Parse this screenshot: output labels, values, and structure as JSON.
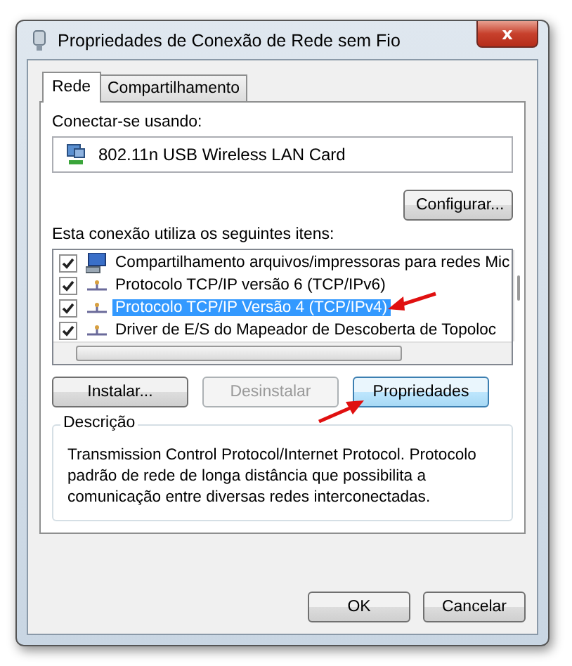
{
  "window": {
    "title": "Propriedades de Conexão de Rede sem Fio",
    "close": "x"
  },
  "tabs": [
    {
      "label": "Rede",
      "selected": true
    },
    {
      "label": "Compartilhamento",
      "selected": false
    }
  ],
  "connect_label": "Conectar-se usando:",
  "adapter": "802.11n USB Wireless LAN Card",
  "configure_button": "Configurar...",
  "items_label": "Esta conexão utiliza os seguintes itens:",
  "items": [
    {
      "label": "Compartilhamento arquivos/impressoras para redes Mic",
      "checked": true,
      "selected": false,
      "kind": "computer"
    },
    {
      "label": "Protocolo TCP/IP versão 6 (TCP/IPv6)",
      "checked": true,
      "selected": false,
      "kind": "protocol"
    },
    {
      "label": "Protocolo TCP/IP Versão 4 (TCP/IPv4)",
      "checked": true,
      "selected": true,
      "kind": "protocol"
    },
    {
      "label": "Driver de E/S do Mapeador de Descoberta de Topoloc",
      "checked": true,
      "selected": false,
      "kind": "protocol"
    }
  ],
  "item_buttons": [
    {
      "label": "Instalar...",
      "disabled": false,
      "focused": false
    },
    {
      "label": "Desinstalar",
      "disabled": true,
      "focused": false
    },
    {
      "label": "Propriedades",
      "disabled": false,
      "focused": true
    }
  ],
  "description": {
    "title": "Descrição",
    "text": "Transmission Control Protocol/Internet Protocol. Protocolo padrão de rede de longa distância que possibilita a comunicação entre diversas redes interconectadas."
  },
  "footer_buttons": [
    "OK",
    "Cancelar"
  ]
}
